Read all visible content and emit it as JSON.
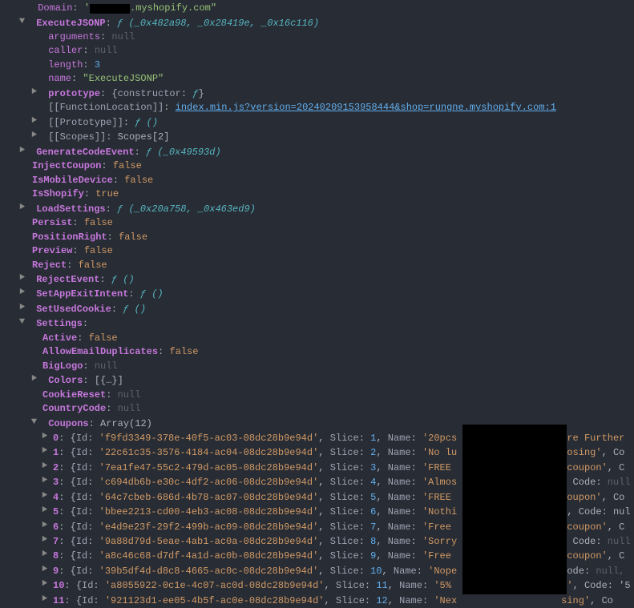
{
  "domain": {
    "key": "Domain",
    "prefix": "'",
    "suffix": ".myshopify.com\""
  },
  "executeJSONP": {
    "key": "ExecuteJSONP",
    "sig": "(_0x482a98, _0x28419e, _0x16c116)",
    "arguments": {
      "key": "arguments",
      "value": "null"
    },
    "caller": {
      "key": "caller",
      "value": "null"
    },
    "length": {
      "key": "length",
      "value": "3"
    },
    "name": {
      "key": "name",
      "value": "\"ExecuteJSONP\""
    },
    "prototype": {
      "key": "prototype",
      "open": "{",
      "ctor": "constructor",
      "suffix": "}"
    },
    "funcLoc": {
      "key": "[[FunctionLocation]]",
      "link": "index.min.js?version=20240209153958444&shop=rungne.myshopify.com:1"
    },
    "proto": {
      "key": "[[Prototype]]",
      "sig": "()"
    },
    "scopes": {
      "key": "[[Scopes]]",
      "value": "Scopes[2]"
    }
  },
  "generateCodeEvent": {
    "key": "GenerateCodeEvent",
    "sig": "(_0x49593d)"
  },
  "injectCoupon": {
    "key": "InjectCoupon",
    "value": "false"
  },
  "isMobileDevice": {
    "key": "IsMobileDevice",
    "value": "false"
  },
  "isShopify": {
    "key": "IsShopify",
    "value": "true"
  },
  "loadSettings": {
    "key": "LoadSettings",
    "sig": "(_0x20a758, _0x463ed9)"
  },
  "persist": {
    "key": "Persist",
    "value": "false"
  },
  "positionRight": {
    "key": "PositionRight",
    "value": "false"
  },
  "preview": {
    "key": "Preview",
    "value": "false"
  },
  "reject": {
    "key": "Reject",
    "value": "false"
  },
  "rejectEvent": {
    "key": "RejectEvent",
    "sig": "()"
  },
  "setAppExitIntent": {
    "key": "SetAppExitIntent",
    "sig": "()"
  },
  "setUsedCookie": {
    "key": "SetUsedCookie",
    "sig": "()"
  },
  "settings": {
    "key": "Settings"
  },
  "active": {
    "key": "Active",
    "value": "false"
  },
  "allowDup": {
    "key": "AllowEmailDuplicates",
    "value": "false"
  },
  "bigLogo": {
    "key": "BigLogo",
    "value": "null"
  },
  "colors": {
    "key": "Colors",
    "value": "[{…}]"
  },
  "cookieReset": {
    "key": "CookieReset",
    "value": "null"
  },
  "countryCode": {
    "key": "CountryCode",
    "value": "null"
  },
  "coupons": {
    "key": "Coupons",
    "value": "Array(12)"
  },
  "chart_data": {
    "type": "table",
    "title": "Coupons Array(12)",
    "columns": [
      "index",
      "Id",
      "Slice",
      "Name",
      "Code"
    ],
    "rows": [
      {
        "index": 0,
        "Id": "'f9fd3349-378e-40f5-ac03-08dc28b9e94d'",
        "Slice": 1,
        "Name": "'20pcs",
        "tail": "ure Further"
      },
      {
        "index": 1,
        "Id": "'22c61c35-3576-4184-ac04-08dc28b9e94d'",
        "Slice": 2,
        "Name": "'No lu",
        "tail": "losing'",
        "Code": ", Co"
      },
      {
        "index": 2,
        "Id": "'7ea1fe47-55c2-479d-ac05-08dc28b9e94d'",
        "Slice": 3,
        "Name": "'FREE ",
        "tail": "'coupon'",
        "Code": ", C"
      },
      {
        "index": 3,
        "Id": "'c694db6b-e30c-4df2-ac06-08dc28b9e94d'",
        "Slice": 4,
        "Name": "'Almos",
        "tail": ", Code:",
        "Code": "null"
      },
      {
        "index": 4,
        "Id": "'64c7cbeb-686d-4b78-ac07-08dc28b9e94d'",
        "Slice": 5,
        "Name": "'FREE ",
        "tail": "coupon'",
        "Code": ", Co"
      },
      {
        "index": 5,
        "Id": "'bbee2213-cd00-4eb3-ac08-08dc28b9e94d'",
        "Slice": 6,
        "Name": "'Nothi",
        "tail": "'",
        "Code": ", Code: nul"
      },
      {
        "index": 6,
        "Id": "'e4d9e23f-29f2-499b-ac09-08dc28b9e94d'",
        "Slice": 7,
        "Name": "'Free ",
        "tail": "'coupon'",
        "Code": ", C"
      },
      {
        "index": 7,
        "Id": "'9a88d79d-5eae-4ab1-ac0a-08dc28b9e94d'",
        "Slice": 8,
        "Name": "'Sorry",
        "tail": ", Code:",
        "Code": "null"
      },
      {
        "index": 8,
        "Id": "'a8c46c68-d7df-4a1d-ac0b-08dc28b9e94d'",
        "Slice": 9,
        "Name": "'Free ",
        "tail": "'coupon'",
        "Code": ", C"
      },
      {
        "index": 9,
        "Id": "'39b5df4d-d8c8-4665-ac0c-08dc28b9e94d'",
        "Slice": 10,
        "Name": "'Nope",
        "tail": "Code:",
        "Code": "null,"
      },
      {
        "index": 10,
        "Id": "'a8055922-0c1e-4c07-ac0d-08dc28b9e94d'",
        "Slice": 11,
        "Name": "'5% ",
        "tail": "n'",
        "Code": ", Code: '5"
      },
      {
        "index": 11,
        "Id": "'921123d1-ee05-4b5f-ac0e-08dc28b9e94d'",
        "Slice": 12,
        "Name": "'Nex",
        "tail": "sing'",
        "Code": ", Co"
      }
    ]
  },
  "labels": {
    "id": "Id",
    "slice": "Slice",
    "name": "Name",
    "code": "Code",
    "f": "ƒ"
  }
}
